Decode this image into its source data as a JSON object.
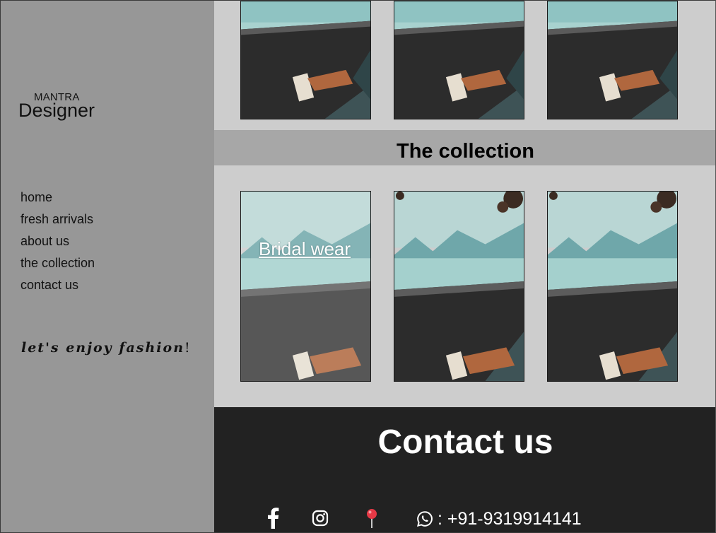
{
  "brand": {
    "small": "MANTRA",
    "big": "Designer"
  },
  "nav": {
    "items": [
      {
        "label": "home"
      },
      {
        "label": "fresh arrivals"
      },
      {
        "label": "about us"
      },
      {
        "label": "the collection"
      },
      {
        "label": "contact us"
      }
    ]
  },
  "tagline": "let's enjoy fashion",
  "tagline_end": "!",
  "collection": {
    "heading": "The collection",
    "first_label": "Bridal wear"
  },
  "contact": {
    "heading": "Contact us",
    "phone": ": +91-9319914141",
    "icons": [
      "facebook-icon",
      "instagram-icon",
      "location-pin-icon",
      "whatsapp-icon"
    ]
  },
  "colors": {
    "sidebar": "#979797",
    "main": "#cdcdcd",
    "band": "#a7a7a7",
    "contact": "#222222",
    "pin": "#e63946"
  }
}
